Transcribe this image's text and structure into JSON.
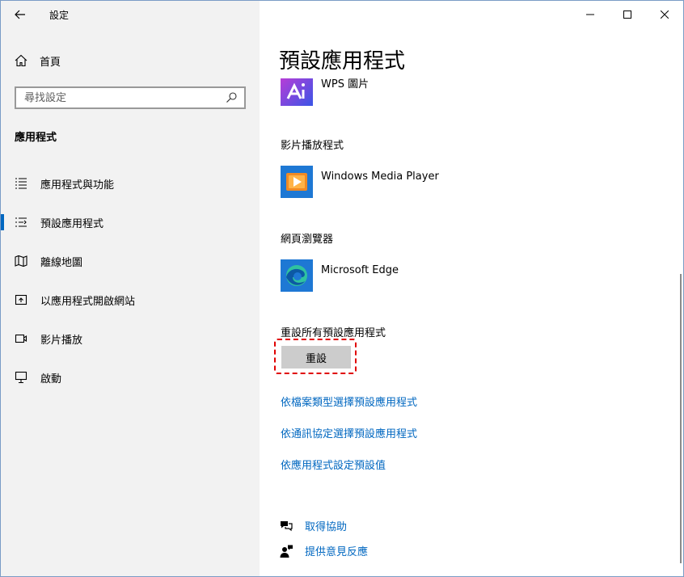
{
  "window": {
    "title": "設定"
  },
  "sidebar": {
    "home_label": "首頁",
    "search_placeholder": "尋找設定",
    "section_title": "應用程式",
    "items": [
      {
        "label": "應用程式與功能",
        "icon": "apps-list-icon"
      },
      {
        "label": "預設應用程式",
        "icon": "default-apps-icon",
        "active": true
      },
      {
        "label": "離線地圖",
        "icon": "map-icon"
      },
      {
        "label": "以應用程式開啟網站",
        "icon": "open-website-icon"
      },
      {
        "label": "影片播放",
        "icon": "video-icon"
      },
      {
        "label": "啟動",
        "icon": "startup-icon"
      }
    ]
  },
  "main": {
    "page_title": "預設應用程式",
    "partial_app_name": "WPS 圖片",
    "video_player": {
      "category": "影片播放程式",
      "app": "Windows Media Player"
    },
    "web_browser": {
      "category": "網頁瀏覽器",
      "app": "Microsoft Edge"
    },
    "reset": {
      "label": "重設所有預設應用程式",
      "button": "重設"
    },
    "links": [
      "依檔案類型選擇預設應用程式",
      "依通訊協定選擇預設應用程式",
      "依應用程式設定預設值"
    ],
    "help": {
      "get_help": "取得協助",
      "feedback": "提供意見反應"
    }
  },
  "colors": {
    "accent": "#0067c0",
    "sidebar_bg": "#f2f2f2",
    "highlight": "#e00000"
  }
}
